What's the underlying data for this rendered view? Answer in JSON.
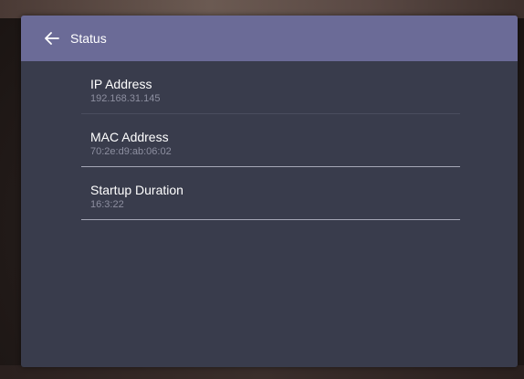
{
  "header": {
    "title": "Status",
    "back_icon": "arrow-left-icon"
  },
  "items": [
    {
      "title": "IP Address",
      "value": "192.168.31.145"
    },
    {
      "title": "MAC Address",
      "value": "70:2e:d9:ab:06:02"
    },
    {
      "title": "Startup Duration",
      "value": "16:3:22"
    }
  ],
  "colors": {
    "header_bg": "#6b6b97",
    "panel_bg": "#393c4c",
    "value_text": "#8d8fa0",
    "divider": "#a6a8b6"
  }
}
